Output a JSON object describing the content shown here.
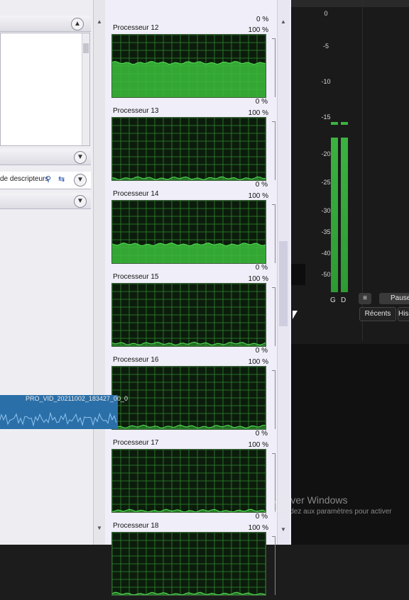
{
  "left_panel": {
    "search_text": "de descripteurs"
  },
  "processors": [
    {
      "name": "Processeur 12",
      "top_pct": "100 %",
      "bottom_pct": "0 %",
      "level": 0.55
    },
    {
      "name": "Processeur 13",
      "top_pct": "100 %",
      "bottom_pct": "0 %",
      "level": 0.03
    },
    {
      "name": "Processeur 14",
      "top_pct": "100 %",
      "bottom_pct": "0 %",
      "level": 0.3
    },
    {
      "name": "Processeur 15",
      "top_pct": "100 %",
      "bottom_pct": "0 %",
      "level": 0.04
    },
    {
      "name": "Processeur 16",
      "top_pct": "100 %",
      "bottom_pct": "0 %",
      "level": 0.04
    },
    {
      "name": "Processeur 17",
      "top_pct": "100 %",
      "bottom_pct": "0 %",
      "level": 0.02
    },
    {
      "name": "Processeur 18",
      "top_pct": "100 %",
      "bottom_pct": "",
      "level": 0.02
    }
  ],
  "first_bottom_pct": "0 %",
  "audio_meter": {
    "scale": [
      "0",
      "-5",
      "-10",
      "-15",
      "-20",
      "-25",
      "-30",
      "-35",
      "-40",
      "-50"
    ],
    "channel_left": "G",
    "channel_right": "D"
  },
  "pause_label": "Pause",
  "recents_tab": "Récents",
  "history_tab": "His",
  "clip_name": "PRO_VID_20211002_183427_00_0",
  "activation": {
    "title": "Activer Windows",
    "subtitle": "Accédez aux paramètres pour activer"
  },
  "colors": {
    "graph_bg": "#0c1c0c",
    "graph_grid": "#2f8a2f",
    "graph_line": "#4fd34f",
    "meter_green": "#3bb340"
  }
}
